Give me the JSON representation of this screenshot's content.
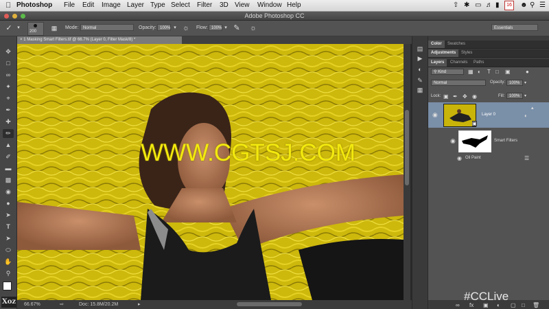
{
  "menubar": {
    "app": "Photoshop",
    "items": [
      "File",
      "Edit",
      "Image",
      "Layer",
      "Type",
      "Select",
      "Filter",
      "3D",
      "View",
      "Window",
      "Help"
    ],
    "calendar_day": "16"
  },
  "window": {
    "title": "Adobe Photoshop CC"
  },
  "options": {
    "brush_size": "200",
    "mode_label": "Mode:",
    "mode_value": "Normal",
    "opacity_label": "Opacity:",
    "opacity_value": "100%",
    "flow_label": "Flow:",
    "flow_value": "100%",
    "workspace": "Essentials"
  },
  "document": {
    "tab_title": "1 Masking Smart Filters.tif @ 66.7% (Layer 0, Filter Mask/8) *",
    "zoom": "66.67%",
    "doc_info": "Doc: 15.8M/20.2M"
  },
  "panels": {
    "top_tabs": [
      "Color",
      "Swatches"
    ],
    "mid_tabs": [
      "Adjustments",
      "Styles"
    ],
    "layer_tabs": [
      "Layers",
      "Channels",
      "Paths"
    ],
    "kind_label": "Kind",
    "blend_mode": "Normal",
    "opacity_label": "Opacity:",
    "opacity_value": "100%",
    "lock_label": "Lock:",
    "fill_label": "Fill:",
    "fill_value": "100%",
    "layer_name": "Layer 0",
    "smart_filters_label": "Smart Filters",
    "filter_name": "Oil Paint"
  },
  "overlay": {
    "watermark": "WWW.CGTSJ.COM",
    "hashtag": "#CCLive",
    "corner_logo": "Xoz"
  },
  "colors": {
    "canvas_yellow": "#c9b40a",
    "layer_selected": "#7a8fa8",
    "watermark": "#f3e90e"
  }
}
